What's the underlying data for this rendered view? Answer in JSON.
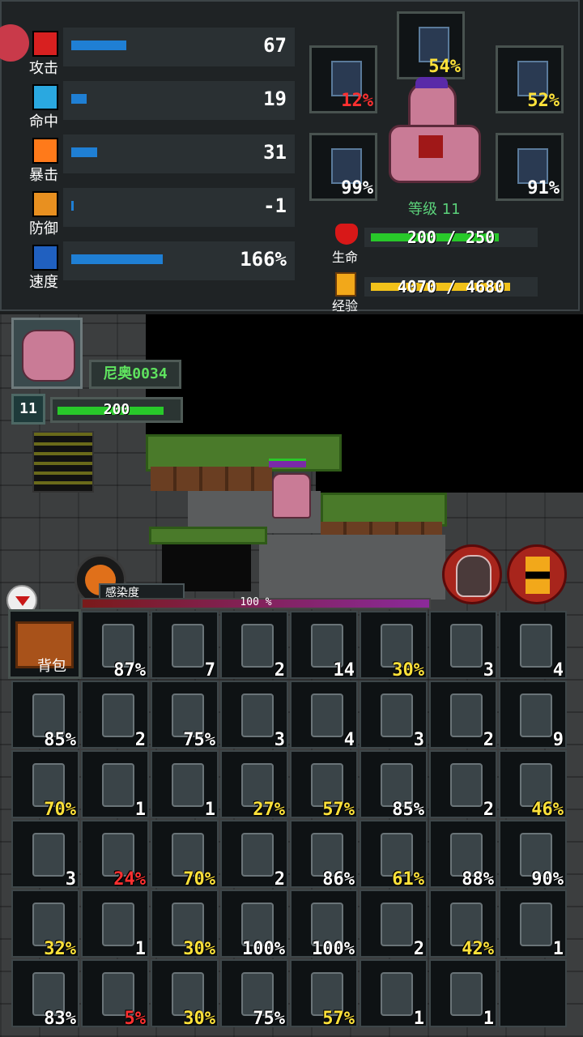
{
  "stats": [
    {
      "label": "攻击",
      "value": "67",
      "level": 0.25,
      "icon": "attack-icon",
      "color": "#d82020"
    },
    {
      "label": "命中",
      "value": "19",
      "level": 0.07,
      "icon": "accuracy-icon",
      "color": "#2aa8e0"
    },
    {
      "label": "暴击",
      "value": "31",
      "level": 0.12,
      "icon": "critical-icon",
      "color": "#ff7a1a"
    },
    {
      "label": "防御",
      "value": "-1",
      "level": 0.01,
      "icon": "defense-icon",
      "color": "#e89020"
    },
    {
      "label": "速度",
      "value": "166%",
      "level": 0.42,
      "icon": "speed-icon",
      "color": "#2060c0"
    }
  ],
  "equipment": [
    {
      "slot": "boots",
      "pct": "54%",
      "color": "#ffe23a"
    },
    {
      "slot": "left-module",
      "pct": "12%",
      "color": "#ff3030"
    },
    {
      "slot": "right-module",
      "pct": "52%",
      "color": "#ffe23a"
    },
    {
      "slot": "staff",
      "pct": "99%",
      "color": "#ffffff"
    },
    {
      "slot": "sword",
      "pct": "91%",
      "color": "#ffffff"
    }
  ],
  "character": {
    "level_label": "等级 11"
  },
  "vitals": {
    "hp_label": "生命",
    "hp_text": "200 / 250",
    "hp_fraction": 0.8,
    "exp_label": "经验",
    "exp_text": "4070 / 4680",
    "exp_fraction": 0.87
  },
  "player": {
    "name": "尼奥0034",
    "level": "11",
    "hp": "200",
    "hp_fraction": 0.9
  },
  "infection": {
    "label": "感染度",
    "text": "100 %",
    "fraction": 1.0
  },
  "backpack": {
    "label": "背包"
  },
  "inventory": [
    [
      "87%",
      "7",
      "2",
      "14",
      "30%",
      "3",
      "4"
    ],
    [
      "85%",
      "2",
      "75%",
      "3",
      "4",
      "3",
      "2",
      "9"
    ],
    [
      "70%",
      "1",
      "1",
      "27%",
      "57%",
      "85%",
      "2",
      "46%"
    ],
    [
      "3",
      "24%",
      "70%",
      "2",
      "86%",
      "61%",
      "88%",
      "90%"
    ],
    [
      "32%",
      "1",
      "30%",
      "100%",
      "100%",
      "2",
      "42%",
      "1"
    ],
    [
      "83%",
      "5%",
      "30%",
      "75%",
      "57%",
      "1",
      "1",
      ""
    ]
  ],
  "inventory_icons": [
    [
      "flashlight-icon",
      "bomb-icon",
      "bear-trap-icon",
      "brain-icon",
      "metal-plate-icon",
      "medicine-bottle-icon",
      "syringe-icon"
    ],
    [
      "fire-extinguisher-icon",
      "green-bottle-icon",
      "fire-extinguisher-icon",
      "purple-bottle-icon",
      "molotov-icon",
      "tnt-icon",
      "flask-icon",
      "fried-egg-icon"
    ],
    [
      "metal-plate-icon",
      "beer-bottle-icon",
      "medkit-icon",
      "zombie-hand-icon",
      "zombie-hand-icon",
      "green-cloth-icon",
      "small-bottle-icon",
      "module-icon"
    ],
    [
      "bone-icon",
      "torch-icon",
      "metal-plate-icon",
      "potted-plant-icon",
      "orange-module-icon",
      "book-icon",
      "swiss-knife-icon",
      "swiss-knife-icon"
    ],
    [
      "axe-icon",
      "landmine-icon",
      "slingshot-icon",
      "knife-icon",
      "brass-knuckles-icon",
      "green-apple-icon",
      "book-icon",
      "vial-icon"
    ],
    [
      "zombie-hand-icon",
      "red-backpack-icon",
      "zombie-hand-icon",
      "green-cloth-icon",
      "zombie-hand-icon",
      "egg-icon",
      "battery-icon",
      "empty-slot"
    ]
  ],
  "inventory_colors": [
    [
      "#ffffff",
      "#ffffff",
      "#ffffff",
      "#ffffff",
      "#ffe23a",
      "#ffffff",
      "#ffffff"
    ],
    [
      "#ffffff",
      "#ffffff",
      "#ffffff",
      "#ffffff",
      "#ffffff",
      "#ffffff",
      "#ffffff",
      "#ffffff"
    ],
    [
      "#ffe23a",
      "#ffffff",
      "#ffffff",
      "#ffe23a",
      "#ffe23a",
      "#ffffff",
      "#ffffff",
      "#ffe23a"
    ],
    [
      "#ffffff",
      "#ff3030",
      "#ffe23a",
      "#ffffff",
      "#ffffff",
      "#ffe23a",
      "#ffffff",
      "#ffffff"
    ],
    [
      "#ffe23a",
      "#ffffff",
      "#ffe23a",
      "#ffffff",
      "#ffffff",
      "#ffffff",
      "#ffe23a",
      "#ffffff"
    ],
    [
      "#ffffff",
      "#ff3030",
      "#ffe23a",
      "#ffffff",
      "#ffe23a",
      "#ffffff",
      "#ffffff",
      "#ffffff"
    ]
  ]
}
